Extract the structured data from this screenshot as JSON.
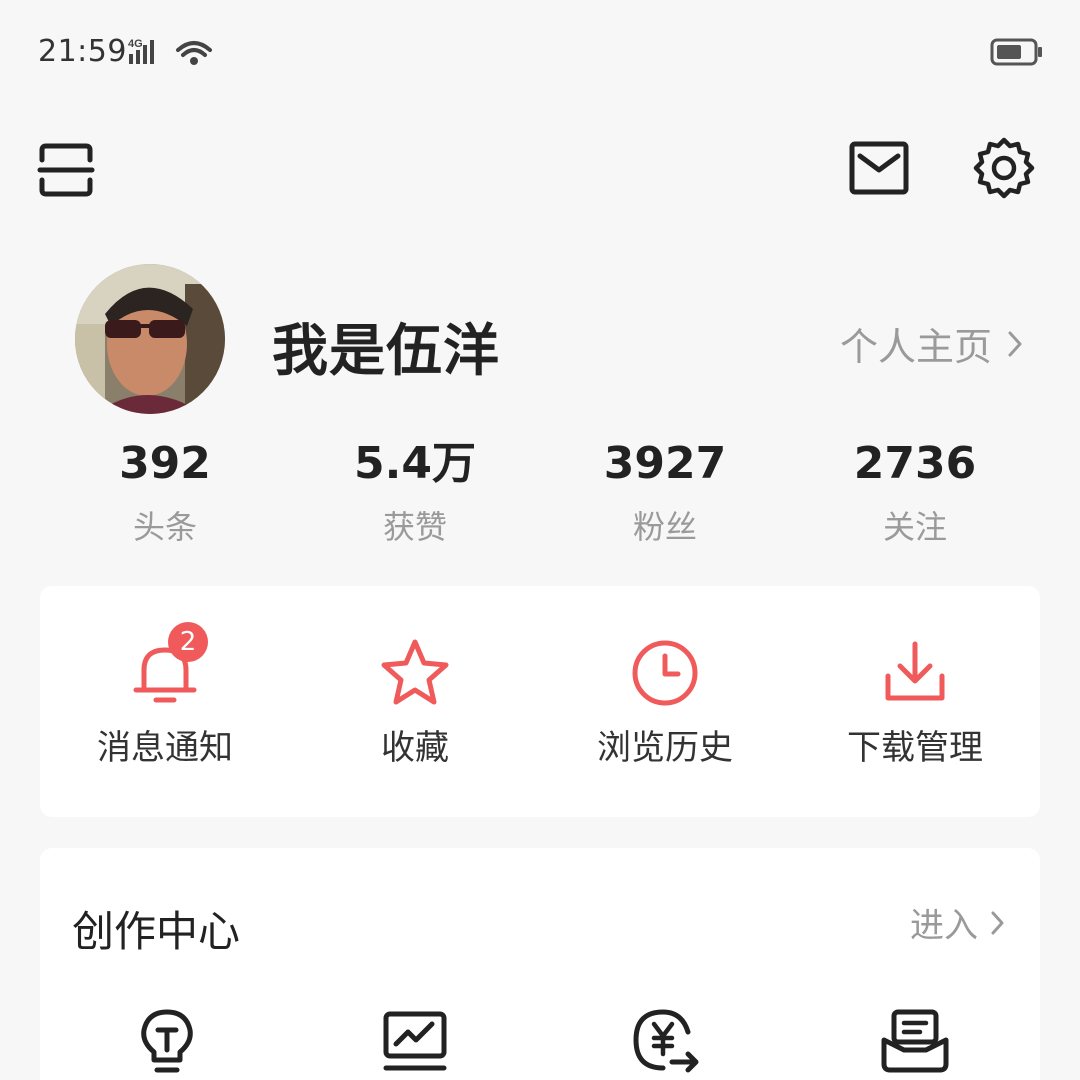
{
  "status_bar": {
    "time": "21:59",
    "network": "4G"
  },
  "profile": {
    "username": "我是伍洋",
    "homepage_link": "个人主页"
  },
  "stats": [
    {
      "value": "392",
      "label": "头条"
    },
    {
      "value": "5.4万",
      "label": "获赞"
    },
    {
      "value": "3927",
      "label": "粉丝"
    },
    {
      "value": "2736",
      "label": "关注"
    }
  ],
  "quick_actions": [
    {
      "label": "消息通知",
      "icon": "bell-icon",
      "badge": "2"
    },
    {
      "label": "收藏",
      "icon": "star-icon"
    },
    {
      "label": "浏览历史",
      "icon": "clock-icon"
    },
    {
      "label": "下载管理",
      "icon": "download-icon"
    }
  ],
  "creator_center": {
    "title": "创作中心",
    "enter_label": "进入",
    "icons": [
      "lightbulb-icon",
      "chart-icon",
      "yuan-transfer-icon",
      "inbox-icon"
    ]
  },
  "colors": {
    "accent": "#f05a5a",
    "background": "#f7f7f7",
    "muted_text": "#9a9a9a"
  }
}
